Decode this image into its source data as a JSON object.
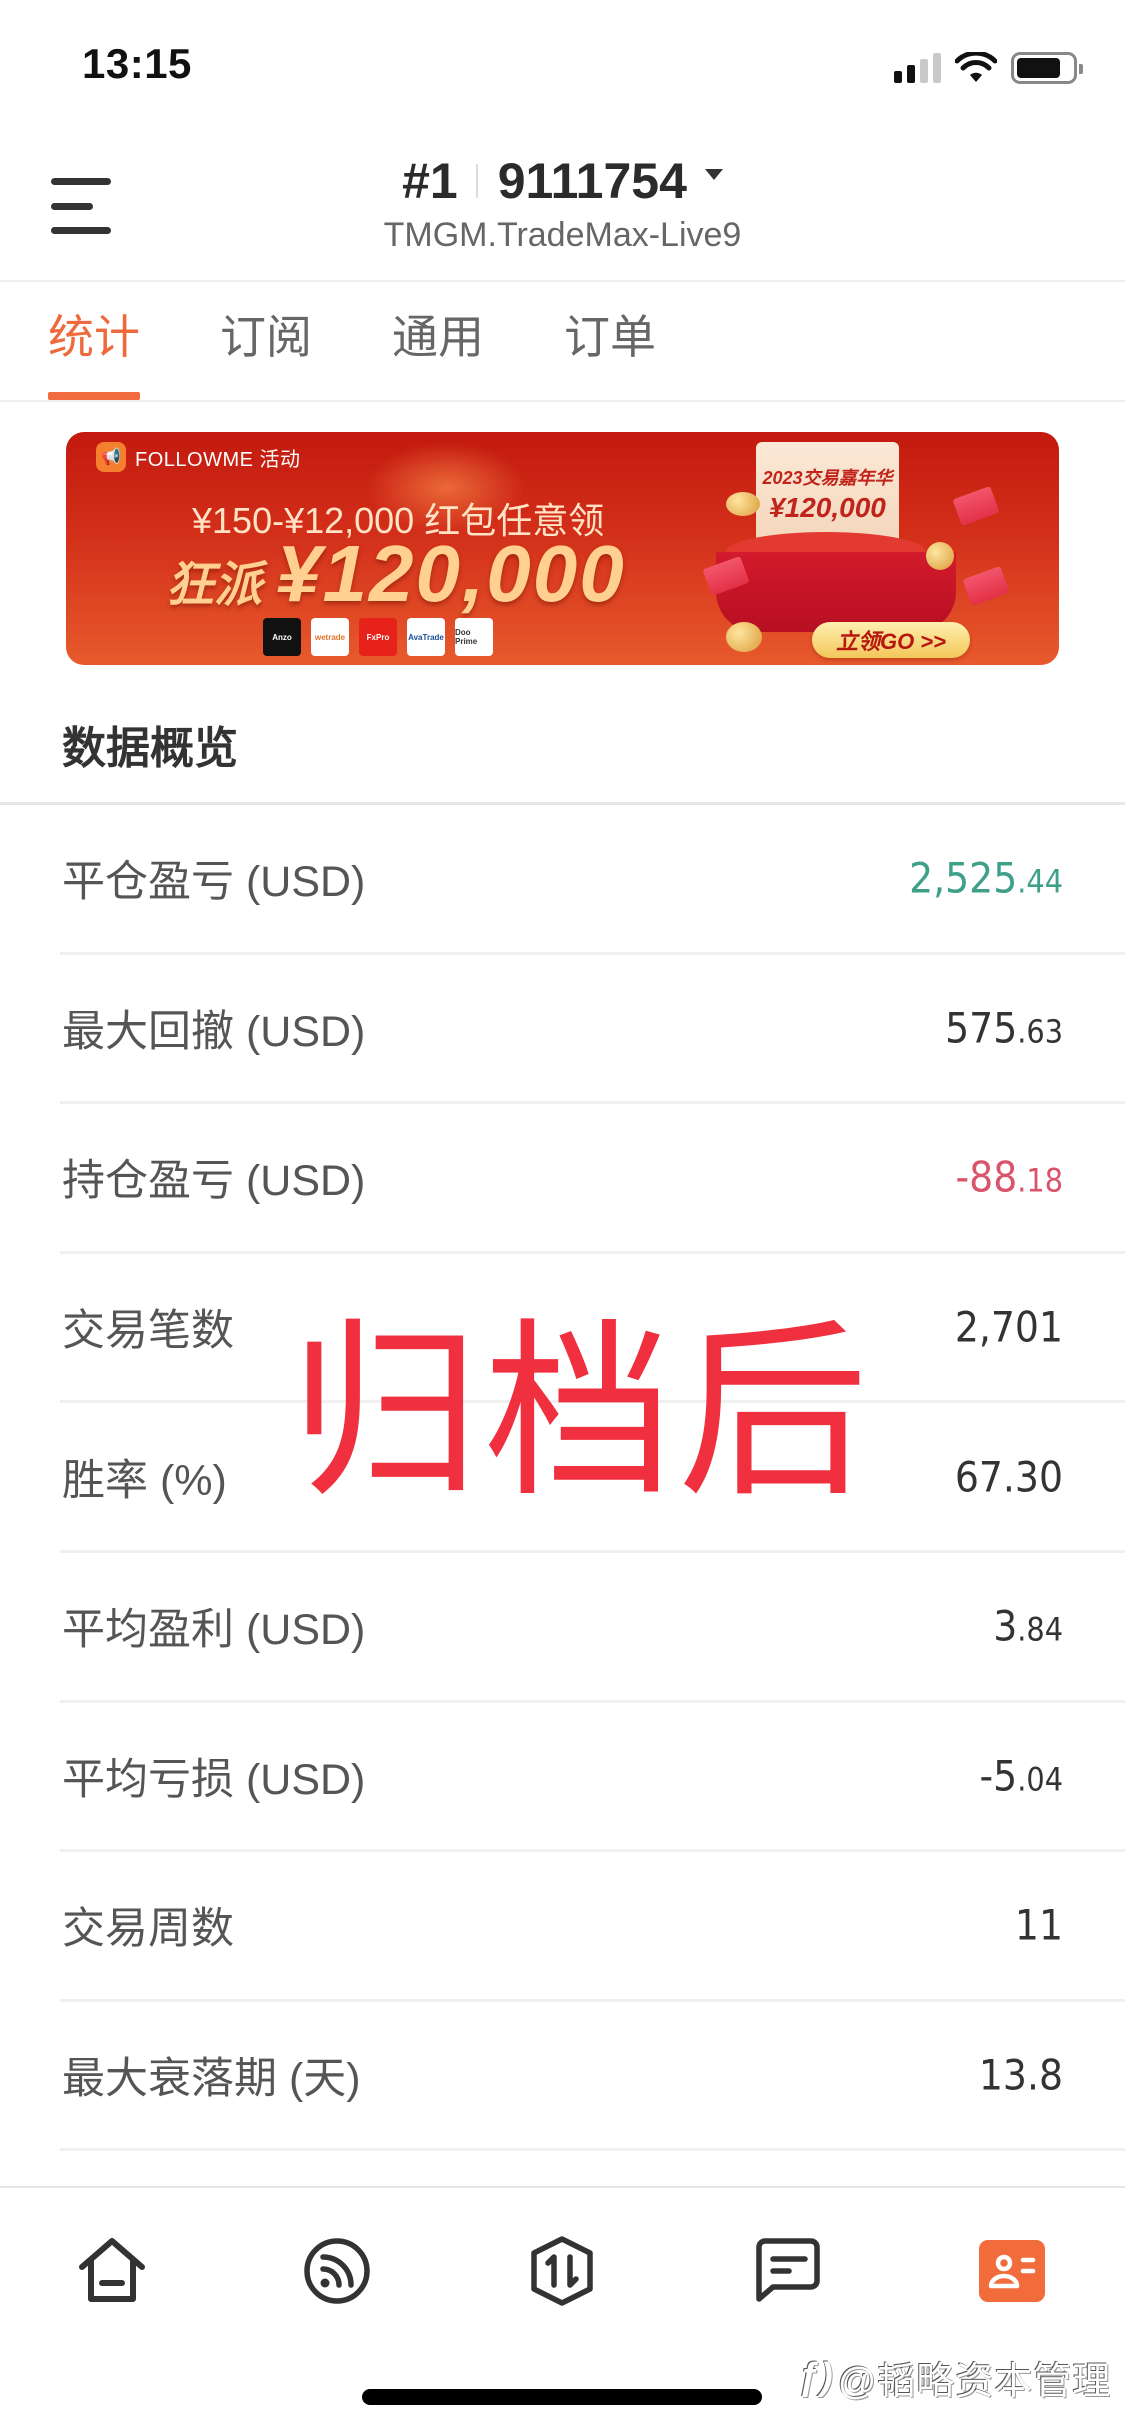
{
  "status_bar": {
    "time": "13:15",
    "signal_bars_active": 2,
    "signal_bars_total": 4,
    "battery_level": 0.8
  },
  "header": {
    "account_index": "#1",
    "account_number": "9111754",
    "server": "TMGM.TradeMax-Live9",
    "menu_icon": "hamburger-menu-icon",
    "dropdown_icon": "caret-down-icon"
  },
  "tabs": [
    {
      "label": "统计",
      "active": true
    },
    {
      "label": "订阅",
      "active": false
    },
    {
      "label": "通用",
      "active": false
    },
    {
      "label": "订单",
      "active": false
    }
  ],
  "banner": {
    "badge": "FOLLOWME 活动",
    "line1": "¥150-¥12,000 红包任意领",
    "line2_prefix": "狂派",
    "line2_amount": "¥120,000",
    "card_title": "2023交易嘉年华",
    "card_amount": "¥120,000",
    "cta": "立领GO >>",
    "brand_logos": [
      "Anzo",
      "wetrade",
      "FxPro",
      "AvaTrade",
      "Doo Prime"
    ]
  },
  "section": {
    "title": "数据概览"
  },
  "stats": [
    {
      "label": "平仓盈亏 (USD)",
      "int": "2,525",
      "dec": ".44",
      "tone": "pos"
    },
    {
      "label": "最大回撤 (USD)",
      "int": "575",
      "dec": ".63",
      "tone": ""
    },
    {
      "label": "持仓盈亏 (USD)",
      "int": "-88",
      "dec": ".18",
      "tone": "neg"
    },
    {
      "label": "交易笔数",
      "int": "2,701",
      "dec": "",
      "tone": ""
    },
    {
      "label": "胜率 (%)",
      "int": "67.30",
      "dec": "",
      "tone": ""
    },
    {
      "label": "平均盈利 (USD)",
      "int": "3",
      "dec": ".84",
      "tone": ""
    },
    {
      "label": "平均亏损 (USD)",
      "int": "-5",
      "dec": ".04",
      "tone": ""
    },
    {
      "label": "交易周数",
      "int": "11",
      "dec": "",
      "tone": ""
    },
    {
      "label": "最大衰落期 (天)",
      "int": "13.8",
      "dec": "",
      "tone": ""
    }
  ],
  "overlay_annotation": "归档后",
  "bottom_nav": [
    {
      "name": "home",
      "icon": "home-icon",
      "active": false
    },
    {
      "name": "feed",
      "icon": "rss-feed-icon",
      "active": false
    },
    {
      "name": "trade",
      "icon": "trade-exchange-icon",
      "active": false
    },
    {
      "name": "messages",
      "icon": "message-icon",
      "active": false
    },
    {
      "name": "profile",
      "icon": "profile-card-icon",
      "active": true
    }
  ],
  "watermark": "@韬略资本管理",
  "colors": {
    "accent": "#f06b3d",
    "positive": "#3fa08a",
    "negative": "#d9536a",
    "overlay": "#f0303f"
  }
}
